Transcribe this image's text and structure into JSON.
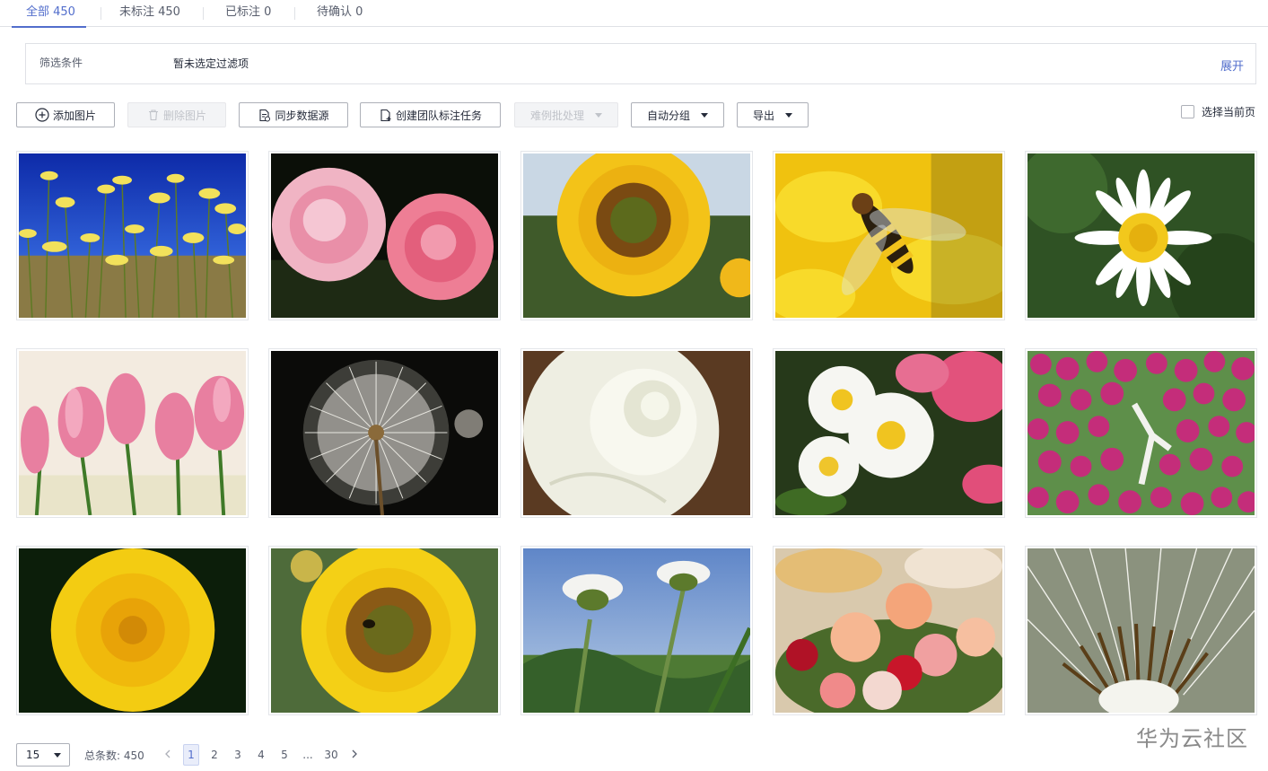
{
  "tabs": [
    {
      "label": "全部 450",
      "active": true
    },
    {
      "label": "未标注 450",
      "active": false
    },
    {
      "label": "已标注 0",
      "active": false
    },
    {
      "label": "待确认 0",
      "active": false
    }
  ],
  "filter": {
    "label": "筛选条件",
    "value": "暂未选定过滤项",
    "expand": "展开"
  },
  "toolbar": {
    "add_image": "添加图片",
    "delete_image": "删除图片",
    "sync_source": "同步数据源",
    "create_team_task": "创建团队标注任务",
    "hard_example": "难例批处理",
    "auto_group": "自动分组",
    "export": "导出",
    "select_page": "选择当前页"
  },
  "images": [
    {
      "subject": "yellow-daisies-blue-sky"
    },
    {
      "subject": "pink-roses"
    },
    {
      "subject": "sunflower"
    },
    {
      "subject": "bee-on-dandelion"
    },
    {
      "subject": "white-daisy"
    },
    {
      "subject": "pink-tulips"
    },
    {
      "subject": "dandelion-seedhead"
    },
    {
      "subject": "white-rose"
    },
    {
      "subject": "wild-roses"
    },
    {
      "subject": "purple-tulip-bunch"
    },
    {
      "subject": "yellow-dandelion"
    },
    {
      "subject": "sunflower-with-bee"
    },
    {
      "subject": "daisies-from-below"
    },
    {
      "subject": "rose-bouquet"
    },
    {
      "subject": "dandelion-closeup"
    }
  ],
  "colors": {
    "accent": "#526ecc",
    "border": "#adb0b8",
    "text": "#252b3a"
  },
  "pagination": {
    "page_size": "15",
    "total": "总条数: 450",
    "pages": [
      "1",
      "2",
      "3",
      "4",
      "5",
      "...",
      "30"
    ],
    "current": "1"
  },
  "watermark": "华为云社区"
}
